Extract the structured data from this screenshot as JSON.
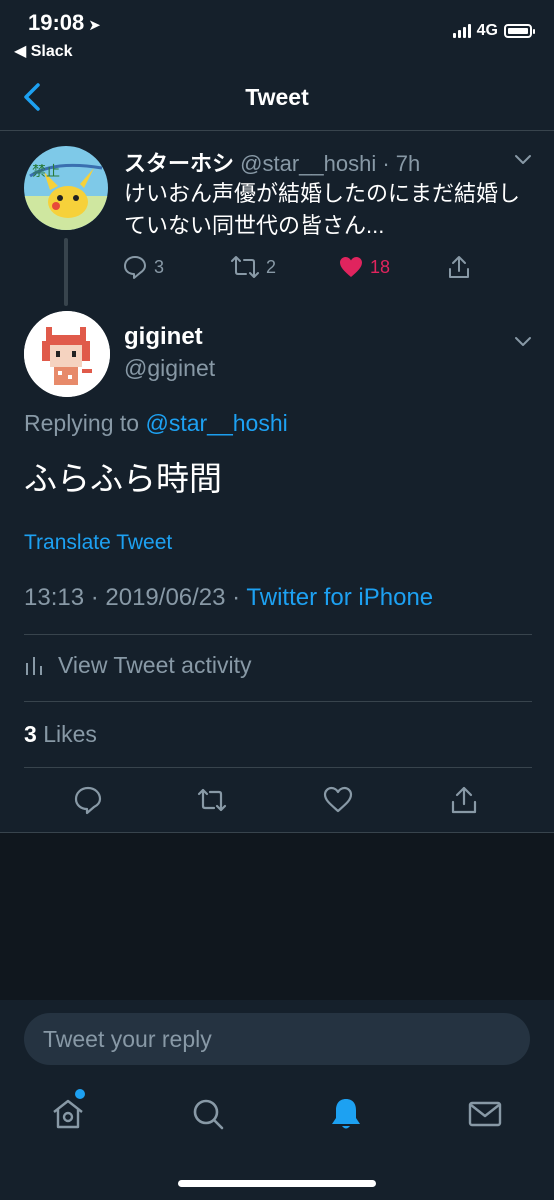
{
  "status_bar": {
    "time": "19:08",
    "back_app": "Slack",
    "network": "4G"
  },
  "nav": {
    "title": "Tweet"
  },
  "parent_tweet": {
    "name": "スターホシ",
    "handle": "@star__hoshi",
    "time": "· 7h",
    "text": "けいおん声優が結婚したのにまだ結婚していない同世代の皆さん...",
    "replies": "3",
    "retweets": "2",
    "likes": "18",
    "liked": true
  },
  "main_tweet": {
    "name": "giginet",
    "handle": "@giginet",
    "replying_prefix": "Replying to",
    "replying_to": "@star__hoshi",
    "text": "ふらふら時間",
    "translate_label": "Translate Tweet",
    "datetime": "13:13 · 2019/06/23 ·",
    "source": "Twitter for iPhone",
    "activity_label": "View Tweet activity",
    "likes_count": "3",
    "likes_label": "Likes"
  },
  "reply_box": {
    "placeholder": "Tweet your reply"
  },
  "tabbar": {
    "items": [
      "home-icon",
      "search-icon",
      "notifications-icon",
      "messages-icon"
    ],
    "active": "notifications-icon",
    "home_has_dot": true
  },
  "colors": {
    "background": "#15202b",
    "accent": "#1da1f2",
    "like": "#e0245e",
    "secondary_text": "#8899a6",
    "divider": "#38444d"
  }
}
